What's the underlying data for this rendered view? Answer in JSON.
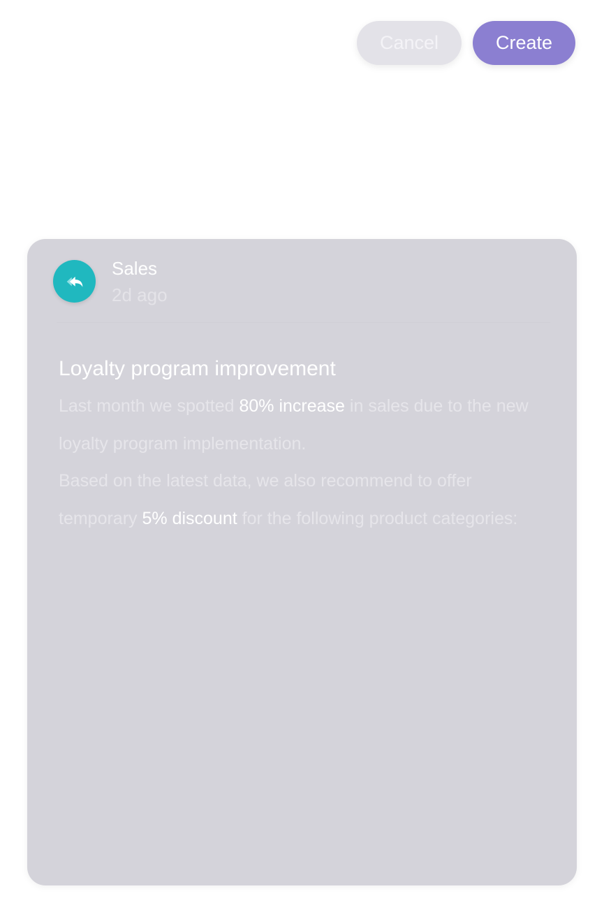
{
  "actions": {
    "cancel_label": "Cancel",
    "create_label": "Create"
  },
  "card": {
    "avatar_icon": "reply-icon",
    "source": "Sales",
    "time": "2d ago",
    "title": "Loyalty program improvement",
    "body": {
      "p1_before": "Last month we spotted ",
      "p1_highlight": "80% increase",
      "p1_after": " in sales due to the new loyalty program implementation.",
      "p2_before": "Based on the latest data, we also recommend to offer temporary ",
      "p2_highlight": "5% discount",
      "p2_after": " for the following product categories:"
    }
  },
  "colors": {
    "accent": "#8b7fd1",
    "avatar_bg": "#20b8bf",
    "card_bg": "#d4d3da"
  }
}
